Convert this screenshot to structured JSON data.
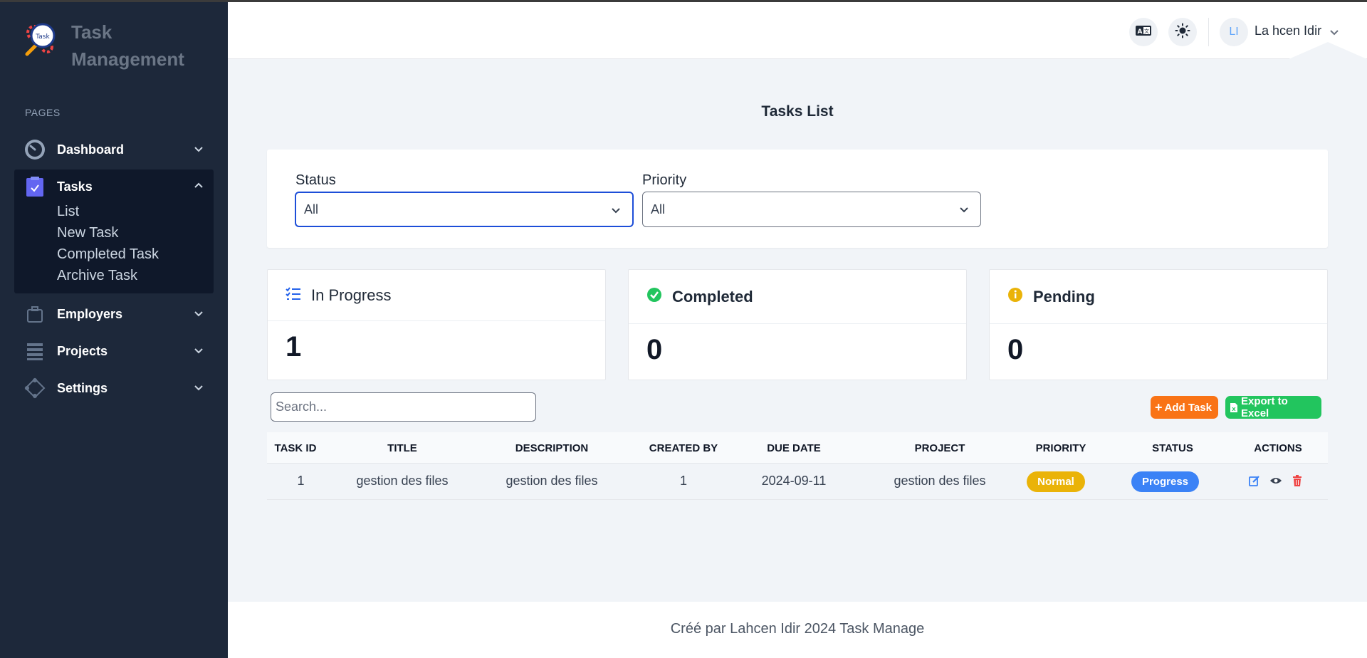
{
  "app": {
    "title_line1": "Task",
    "title_line2": "Management",
    "logo_text": "Task"
  },
  "sidebar": {
    "section_label": "PAGES",
    "items": [
      {
        "label": "Dashboard",
        "icon": "dashboard-icon"
      },
      {
        "label": "Tasks",
        "icon": "clipboard-check-icon"
      },
      {
        "label": "Employers",
        "icon": "briefcase-icon"
      },
      {
        "label": "Projects",
        "icon": "layers-icon"
      },
      {
        "label": "Settings",
        "icon": "settings-icon"
      }
    ],
    "task_subitems": [
      "List",
      "New Task",
      "Completed Task",
      "Archive Task"
    ]
  },
  "header": {
    "translate_icon": "translate-icon",
    "theme_icon": "sun-icon",
    "avatar_initials": "LI",
    "username": "La hcen Idir"
  },
  "page": {
    "title": "Tasks List"
  },
  "filters": {
    "status_label": "Status",
    "status_value": "All",
    "priority_label": "Priority",
    "priority_value": "All"
  },
  "stats": [
    {
      "title": "In Progress",
      "value": "1",
      "icon": "list-check-icon",
      "color": "#2563eb"
    },
    {
      "title": "Completed",
      "value": "0",
      "icon": "check-circle-icon",
      "color": "#22c55e"
    },
    {
      "title": "Pending",
      "value": "0",
      "icon": "info-circle-icon",
      "color": "#eab308"
    }
  ],
  "toolbar": {
    "search_placeholder": "Search...",
    "add_label": "Add Task",
    "export_label": "Export to Excel"
  },
  "table": {
    "headers": [
      "TASK ID",
      "TITLE",
      "DESCRIPTION",
      "CREATED BY",
      "DUE DATE",
      "PROJECT",
      "PRIORITY",
      "STATUS",
      "ACTIONS"
    ],
    "rows": [
      {
        "id": "1",
        "title": "gestion des files",
        "description": "gestion des files",
        "created_by": "1",
        "due_date": "2024-09-11",
        "project": "gestion des files",
        "priority": "Normal",
        "status": "Progress"
      }
    ]
  },
  "colors": {
    "sidebar_bg": "#1d283a",
    "priority_normal": "#eab308",
    "status_progress": "#3b82f6",
    "add_button": "#f97316",
    "export_button": "#22c55e"
  },
  "footer": {
    "text": "Créé par Lahcen Idir 2024 Task Manage"
  }
}
